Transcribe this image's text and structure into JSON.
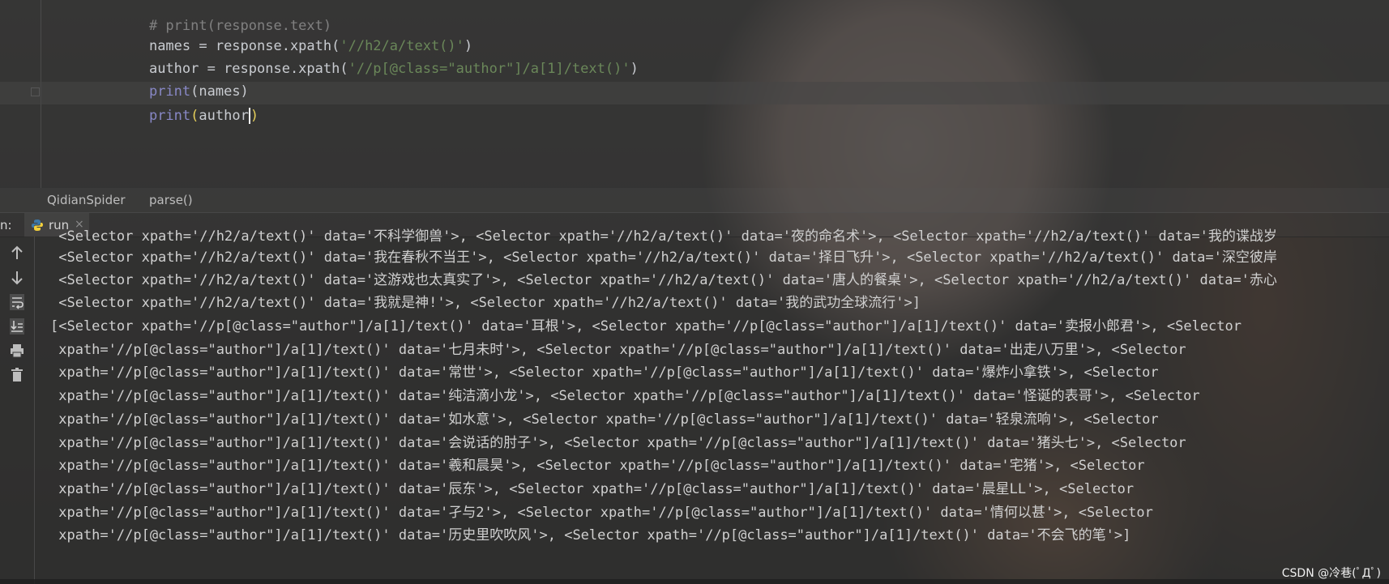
{
  "editor": {
    "lines": [
      "# print(response.text)",
      "names = response.xpath('//h2/a/text()')",
      "author = response.xpath('//p[@class=\"author\"]/a[1]/text()')",
      "print(names)",
      "print(author)"
    ]
  },
  "breadcrumb": {
    "class_name": "QidianSpider",
    "method_name": "parse()"
  },
  "run_panel": {
    "prefix": "n:",
    "tab_label": "run",
    "tab_close": "×"
  },
  "toolbar_icons": [
    "arrow-up-icon",
    "arrow-down-icon",
    "soft-wrap-icon",
    "scroll-to-end-icon",
    "print-icon",
    "trash-icon"
  ],
  "console": {
    "lines": [
      " <Selector xpath='//h2/a/text()' data='不科学御兽'>, <Selector xpath='//h2/a/text()' data='夜的命名术'>, <Selector xpath='//h2/a/text()' data='我的谍战岁",
      " <Selector xpath='//h2/a/text()' data='我在春秋不当王'>, <Selector xpath='//h2/a/text()' data='择日飞升'>, <Selector xpath='//h2/a/text()' data='深空彼岸",
      " <Selector xpath='//h2/a/text()' data='这游戏也太真实了'>, <Selector xpath='//h2/a/text()' data='唐人的餐桌'>, <Selector xpath='//h2/a/text()' data='赤心",
      " <Selector xpath='//h2/a/text()' data='我就是神!'>, <Selector xpath='//h2/a/text()' data='我的武功全球流行'>]",
      "[<Selector xpath='//p[@class=\"author\"]/a[1]/text()' data='耳根'>, <Selector xpath='//p[@class=\"author\"]/a[1]/text()' data='卖报小郎君'>, <Selector",
      " xpath='//p[@class=\"author\"]/a[1]/text()' data='七月未时'>, <Selector xpath='//p[@class=\"author\"]/a[1]/text()' data='出走八万里'>, <Selector",
      " xpath='//p[@class=\"author\"]/a[1]/text()' data='常世'>, <Selector xpath='//p[@class=\"author\"]/a[1]/text()' data='爆炸小拿铁'>, <Selector",
      " xpath='//p[@class=\"author\"]/a[1]/text()' data='纯洁滴小龙'>, <Selector xpath='//p[@class=\"author\"]/a[1]/text()' data='怪诞的表哥'>, <Selector",
      " xpath='//p[@class=\"author\"]/a[1]/text()' data='如水意'>, <Selector xpath='//p[@class=\"author\"]/a[1]/text()' data='轻泉流响'>, <Selector",
      " xpath='//p[@class=\"author\"]/a[1]/text()' data='会说话的肘子'>, <Selector xpath='//p[@class=\"author\"]/a[1]/text()' data='猪头七'>, <Selector",
      " xpath='//p[@class=\"author\"]/a[1]/text()' data='羲和晨昊'>, <Selector xpath='//p[@class=\"author\"]/a[1]/text()' data='宅猪'>, <Selector",
      " xpath='//p[@class=\"author\"]/a[1]/text()' data='辰东'>, <Selector xpath='//p[@class=\"author\"]/a[1]/text()' data='晨星LL'>, <Selector",
      " xpath='//p[@class=\"author\"]/a[1]/text()' data='孑与2'>, <Selector xpath='//p[@class=\"author\"]/a[1]/text()' data='情何以甚'>, <Selector",
      " xpath='//p[@class=\"author\"]/a[1]/text()' data='历史里吹吹风'>, <Selector xpath='//p[@class=\"author\"]/a[1]/text()' data='不会飞的笔'>]"
    ]
  },
  "watermark": "CSDN @冷巷(ﾟДﾟ)"
}
